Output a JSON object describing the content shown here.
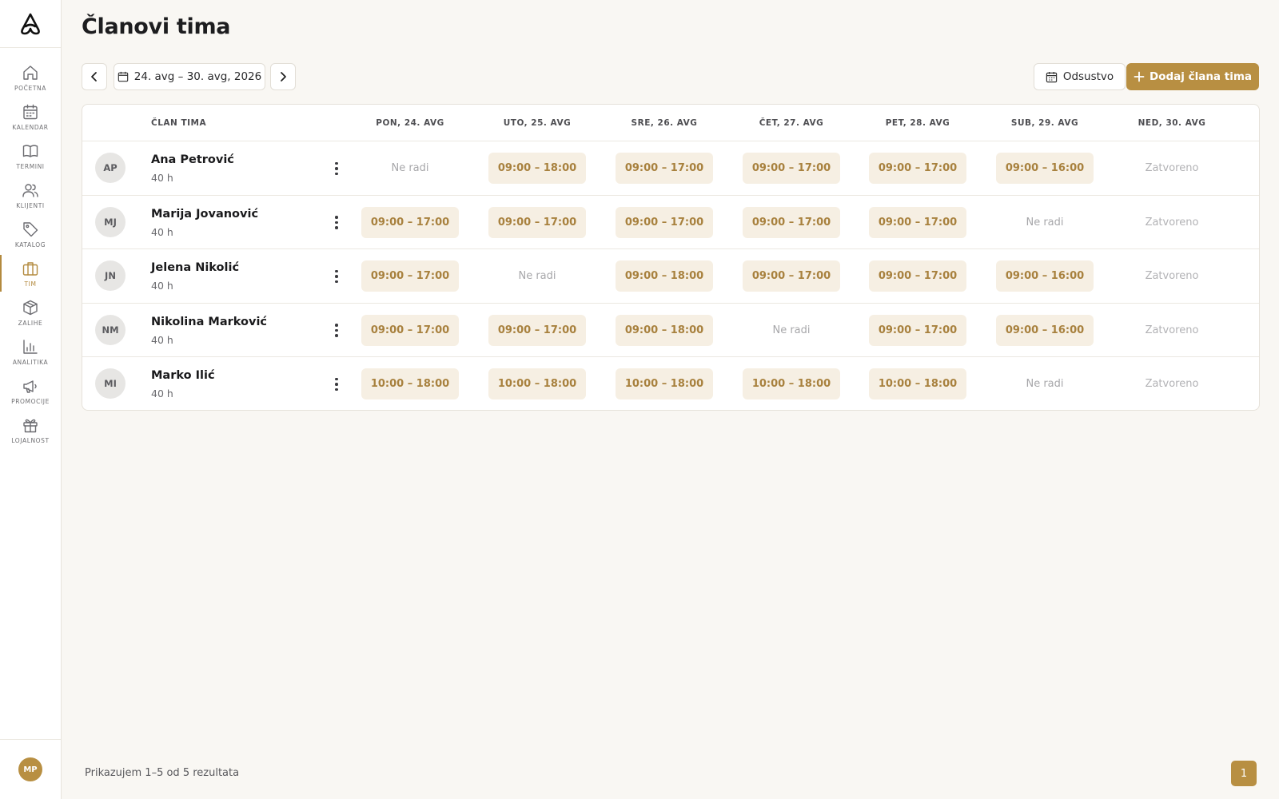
{
  "app": {
    "user_initials": "MP",
    "accent_color": "#b88f42"
  },
  "sidebar": {
    "items": [
      {
        "label": "POČETNA",
        "icon": "home-icon"
      },
      {
        "label": "KALENDAR",
        "icon": "calendar-icon"
      },
      {
        "label": "TERMINI",
        "icon": "book-icon"
      },
      {
        "label": "KLIJENTI",
        "icon": "users-icon"
      },
      {
        "label": "KATALOG",
        "icon": "tag-icon"
      },
      {
        "label": "TIM",
        "icon": "briefcase-icon",
        "active": true
      },
      {
        "label": "ZALIHE",
        "icon": "box-icon"
      },
      {
        "label": "ANALITIKA",
        "icon": "chart-icon"
      },
      {
        "label": "PROMOCIJE",
        "icon": "megaphone-icon"
      },
      {
        "label": "LOJALNOST",
        "icon": "gift-icon"
      }
    ]
  },
  "header": {
    "title": "Članovi tima"
  },
  "toolbar": {
    "date_range": "24. avg – 30. avg, 2026",
    "absence_label": "Odsustvo",
    "add_label": "Dodaj člana tima"
  },
  "table": {
    "member_header": "ČLAN TIMA",
    "days": [
      "PON, 24. AVG",
      "UTO, 25. AVG",
      "SRE, 26. AVG",
      "ČET, 27. AVG",
      "PET, 28. AVG",
      "SUB, 29. AVG",
      "NED, 30. AVG"
    ],
    "rows": [
      {
        "initials": "AP",
        "name": "Ana Petrović",
        "hours": "40 h",
        "shifts": [
          "Ne radi",
          "09:00 – 18:00",
          "09:00 – 17:00",
          "09:00 – 17:00",
          "09:00 – 17:00",
          "09:00 – 16:00",
          "Zatvoreno"
        ]
      },
      {
        "initials": "MJ",
        "name": "Marija Jovanović",
        "hours": "40 h",
        "shifts": [
          "09:00 – 17:00",
          "09:00 – 17:00",
          "09:00 – 17:00",
          "09:00 – 17:00",
          "09:00 – 17:00",
          "Ne radi",
          "Zatvoreno"
        ]
      },
      {
        "initials": "JN",
        "name": "Jelena Nikolić",
        "hours": "40 h",
        "shifts": [
          "09:00 – 17:00",
          "Ne radi",
          "09:00 – 18:00",
          "09:00 – 17:00",
          "09:00 – 17:00",
          "09:00 – 16:00",
          "Zatvoreno"
        ]
      },
      {
        "initials": "NM",
        "name": "Nikolina Marković",
        "hours": "40 h",
        "shifts": [
          "09:00 – 17:00",
          "09:00 – 17:00",
          "09:00 – 18:00",
          "Ne radi",
          "09:00 – 17:00",
          "09:00 – 16:00",
          "Zatvoreno"
        ]
      },
      {
        "initials": "MI",
        "name": "Marko Ilić",
        "hours": "40 h",
        "shifts": [
          "10:00 – 18:00",
          "10:00 – 18:00",
          "10:00 – 18:00",
          "10:00 – 18:00",
          "10:00 – 18:00",
          "Ne radi",
          "Zatvoreno"
        ]
      }
    ]
  },
  "footer": {
    "results_text": "Prikazujem 1–5 od 5 rezultata",
    "current_page": "1"
  }
}
